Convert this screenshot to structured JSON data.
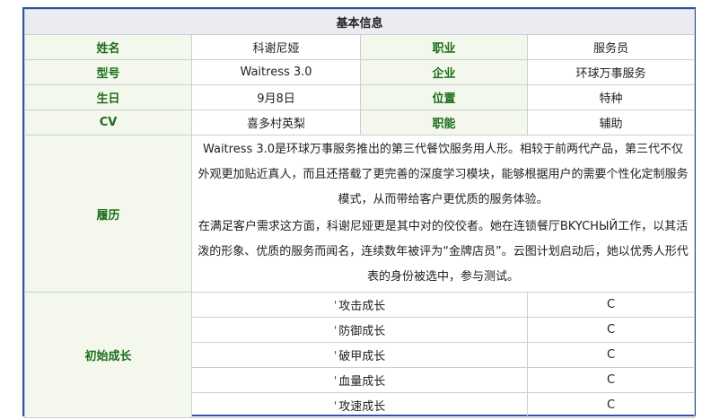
{
  "header": {
    "title": "基本信息"
  },
  "info": [
    {
      "label_left": "姓名",
      "value_left": "科谢尼娅",
      "label_right": "职业",
      "value_right": "服务员"
    },
    {
      "label_left": "型号",
      "value_left": "Waitress 3.0",
      "label_right": "企业",
      "value_right": "环球万事服务"
    },
    {
      "label_left": "生日",
      "value_left": "9月8日",
      "label_right": "位置",
      "value_right": "特种"
    },
    {
      "label_left": "CV",
      "value_left": "喜多村英梨",
      "label_right": "职能",
      "value_right": "辅助"
    }
  ],
  "resume": {
    "label": "履历",
    "p1": "Waitress 3.0是环球万事服务推出的第三代餐饮服务用人形。相较于前两代产品，第三代不仅外观更加贴近真人，而且还搭载了更完善的深度学习模块，能够根据用户的需要个性化定制服务模式，从而带给客户更优质的服务体验。",
    "p2": "在满足客户需求这方面，科谢尼娅更是其中对的佼佼者。她在连锁餐厅BKYCHЫЙ工作，以其活泼的形象、优质的服务而闻名，连续数年被评为“金牌店员”。云图计划启动后，她以优秀人形代表的身份被选中，参与测试。"
  },
  "growth": {
    "label": "初始成长",
    "prefix": "'",
    "items": [
      {
        "name": "攻击成长",
        "grade": "C"
      },
      {
        "name": "防御成长",
        "grade": "C"
      },
      {
        "name": "破甲成长",
        "grade": "C"
      },
      {
        "name": "血量成长",
        "grade": "C"
      },
      {
        "name": "攻速成长",
        "grade": "C"
      }
    ]
  }
}
